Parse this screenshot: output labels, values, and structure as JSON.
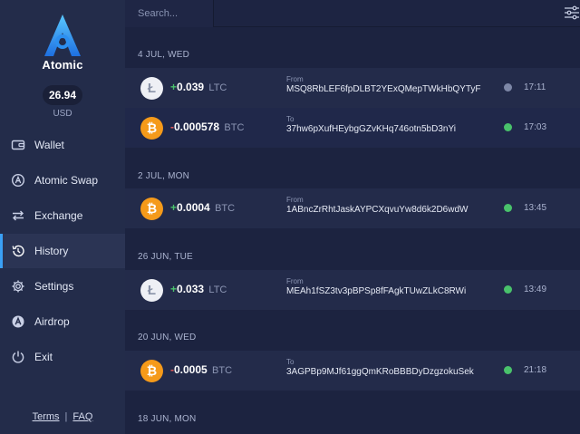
{
  "app": {
    "name": "Atomic",
    "balance": "26.94",
    "currency": "USD",
    "accent": "#3aa0f5"
  },
  "nav": {
    "items": [
      {
        "label": "Wallet",
        "icon": "wallet-icon"
      },
      {
        "label": "Atomic Swap",
        "icon": "atomic-swap-icon"
      },
      {
        "label": "Exchange",
        "icon": "exchange-icon"
      },
      {
        "label": "History",
        "icon": "history-icon",
        "active": true
      },
      {
        "label": "Settings",
        "icon": "gear-icon"
      },
      {
        "label": "Airdrop",
        "icon": "airdrop-icon"
      },
      {
        "label": "Exit",
        "icon": "power-icon"
      }
    ]
  },
  "footer": {
    "terms": "Terms",
    "faq": "FAQ",
    "separator": "|"
  },
  "search": {
    "placeholder": "Search..."
  },
  "history": {
    "groups": [
      {
        "date": "4 JUL, WED",
        "txs": [
          {
            "coin": "LTC",
            "sign": "+",
            "amount": "0.039",
            "unit": "LTC",
            "dir": "From",
            "address": "MSQ8RbLEF6fpDLBT2YExQMepTWkHbQYTyF",
            "status": "pending",
            "time": "17:11"
          },
          {
            "coin": "BTC",
            "sign": "-",
            "amount": "0.000578",
            "unit": "BTC",
            "dir": "To",
            "address": "37hw6pXufHEybgGZvKHq746otn5bD3nYi",
            "status": "done",
            "time": "17:03"
          }
        ]
      },
      {
        "date": "2 JUL, MON",
        "txs": [
          {
            "coin": "BTC",
            "sign": "+",
            "amount": "0.0004",
            "unit": "BTC",
            "dir": "From",
            "address": "1ABncZrRhtJaskAYPCXqvuYw8d6k2D6wdW",
            "status": "done",
            "time": "13:45"
          }
        ]
      },
      {
        "date": "26 JUN, TUE",
        "txs": [
          {
            "coin": "LTC",
            "sign": "+",
            "amount": "0.033",
            "unit": "LTC",
            "dir": "From",
            "address": "MEAh1fSZ3tv3pBPSp8fFAgkTUwZLkC8RWi",
            "status": "done",
            "time": "13:49"
          }
        ]
      },
      {
        "date": "20 JUN, WED",
        "txs": [
          {
            "coin": "BTC",
            "sign": "-",
            "amount": "0.0005",
            "unit": "BTC",
            "dir": "To",
            "address": "3AGPBp9MJf61ggQmKRoBBBDyDzgzokuSek",
            "status": "done",
            "time": "21:18"
          }
        ]
      },
      {
        "date": "18 JUN, MON",
        "txs": []
      }
    ]
  }
}
